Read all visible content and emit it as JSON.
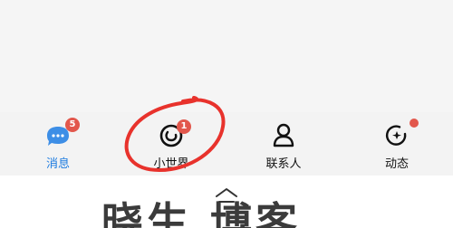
{
  "tab_bar": {
    "tabs": [
      {
        "label": "消息",
        "icon": "chat-bubble-icon",
        "badge": "5",
        "active": true
      },
      {
        "label": "小世界",
        "icon": "planet-icon",
        "badge": "1",
        "active": false
      },
      {
        "label": "联系人",
        "icon": "person-icon",
        "badge": null,
        "active": false
      },
      {
        "label": "动态",
        "icon": "star-refresh-icon",
        "badge": "dot",
        "active": false
      }
    ]
  },
  "watermark": {
    "text": "晓生   博客"
  },
  "colors": {
    "accent": "#1c7be0",
    "badge": "#e2574c",
    "annotation": "#e8322c"
  }
}
